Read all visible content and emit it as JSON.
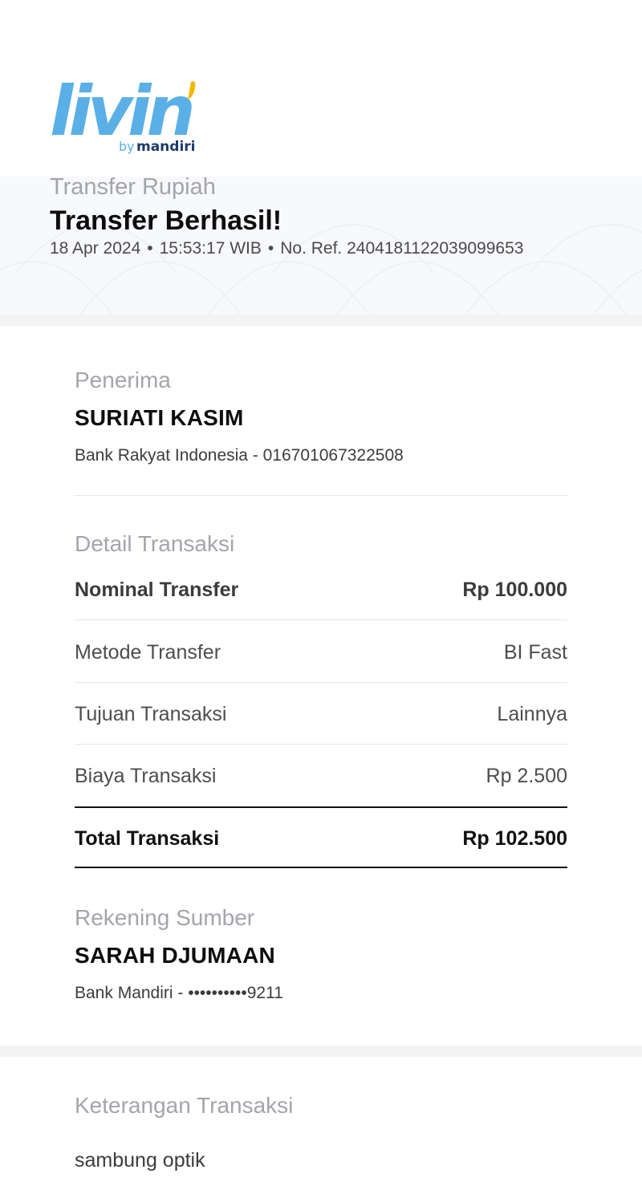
{
  "header": {
    "logo_word": "livin'",
    "logo_byline": "by mandiri",
    "category": "Transfer Rupiah",
    "title": "Transfer Berhasil!",
    "date": "18 Apr 2024",
    "time": "15:53:17 WIB",
    "reference": "No. Ref. 2404181122039099653"
  },
  "recipient": {
    "label": "Penerima",
    "name": "SURIATI KASIM",
    "account": "Bank Rakyat Indonesia - 016701067322508"
  },
  "details": {
    "label": "Detail Transaksi",
    "rows": [
      {
        "key": "Nominal Transfer",
        "value": "Rp 100.000"
      },
      {
        "key": "Metode Transfer",
        "value": "BI Fast"
      },
      {
        "key": "Tujuan Transaksi",
        "value": "Lainnya"
      },
      {
        "key": "Biaya Transaksi",
        "value": "Rp 2.500"
      }
    ],
    "total": {
      "key": "Total Transaksi",
      "value": "Rp 102.500"
    }
  },
  "source": {
    "label": "Rekening Sumber",
    "name": "SARAH DJUMAAN",
    "account": "Bank Mandiri - ••••••••••9211"
  },
  "notes": {
    "label": "Keterangan Transaksi",
    "text": "sambung optik"
  },
  "colors": {
    "logo_blue": "#5aafe6",
    "logo_yellow": "#f5b700",
    "logo_navy": "#1d3a6b",
    "muted_label": "#a4a4ac"
  }
}
